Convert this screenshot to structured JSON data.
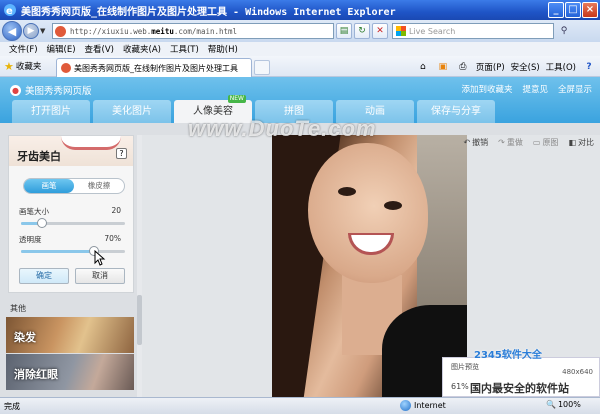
{
  "window": {
    "title": "美图秀秀网页版_在线制作图片及图片处理工具 - Windows Internet Explorer",
    "buttons": {
      "minimize": "_",
      "maximize": "□",
      "close": "×"
    }
  },
  "address": {
    "url_prefix": "http://xiuxiu.web.",
    "url_domain": "meitu",
    "url_suffix": ".com/main.html",
    "search_placeholder": "Live Search"
  },
  "menu": [
    "文件(F)",
    "编辑(E)",
    "查看(V)",
    "收藏夹(A)",
    "工具(T)",
    "帮助(H)"
  ],
  "favorites": {
    "label": "收藏夹"
  },
  "tab": {
    "title": "美图秀秀网页版_在线制作图片及图片处理工具"
  },
  "commandbar": {
    "page": "页面(P)",
    "safety": "安全(S)",
    "tools": "工具(O)"
  },
  "app": {
    "name": "美图秀秀网页版",
    "links": {
      "favorite": "添加到收藏夹",
      "feedback": "提意见",
      "fullscreen": "全屏显示"
    },
    "tabs": [
      {
        "label": "打开图片"
      },
      {
        "label": "美化图片"
      },
      {
        "label": "人像美容",
        "badge": "NEW"
      },
      {
        "label": "拼图"
      },
      {
        "label": "动画"
      },
      {
        "label": "保存与分享"
      }
    ]
  },
  "panel": {
    "title": "牙齿美白",
    "help": "?",
    "modes": [
      "画笔",
      "橡皮擦"
    ],
    "brush_size": {
      "label": "画笔大小",
      "value": "20",
      "fraction": 0.2
    },
    "opacity": {
      "label": "透明度",
      "value": "70%",
      "fraction": 0.7
    },
    "ok": "确定",
    "cancel": "取消"
  },
  "other": {
    "label": "其他",
    "cards": [
      {
        "label": "染发"
      },
      {
        "label": "消除红眼"
      }
    ]
  },
  "photo_tools": {
    "undo": "撤销",
    "redo": "重做",
    "reset": "原图",
    "compare": "对比"
  },
  "zoom": {
    "title": "图片预览",
    "percent": "61%",
    "dims": "480x640"
  },
  "watermarks": {
    "duote": "www.DuoTe.com",
    "site2345": "2345软件大全",
    "slogan": "国内最安全的软件站"
  },
  "status": {
    "text": "完成",
    "zone": "Internet",
    "zoom": "100%"
  }
}
